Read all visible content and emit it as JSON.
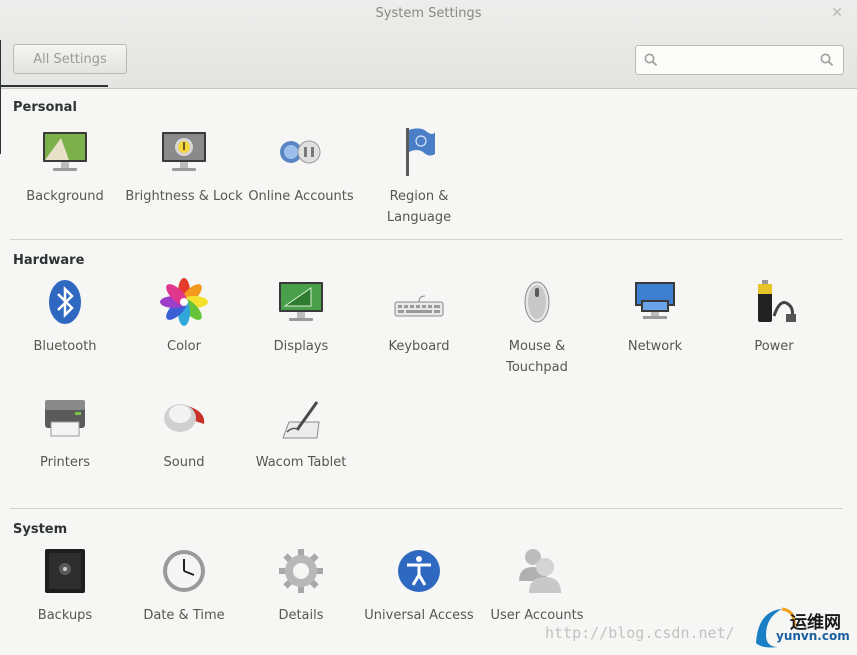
{
  "window": {
    "title": "System Settings"
  },
  "header": {
    "all_settings_label": "All Settings",
    "search_placeholder": ""
  },
  "sections": {
    "personal": {
      "title": "Personal",
      "items": [
        {
          "label": "Background",
          "icon": "background-icon"
        },
        {
          "label": "Brightness & Lock",
          "icon": "brightness-lock-icon"
        },
        {
          "label": "Online Accounts",
          "icon": "online-accounts-icon"
        },
        {
          "label": "Region & Language",
          "icon": "region-language-icon"
        }
      ]
    },
    "hardware": {
      "title": "Hardware",
      "items": [
        {
          "label": "Bluetooth",
          "icon": "bluetooth-icon"
        },
        {
          "label": "Color",
          "icon": "color-icon"
        },
        {
          "label": "Displays",
          "icon": "displays-icon"
        },
        {
          "label": "Keyboard",
          "icon": "keyboard-icon"
        },
        {
          "label": "Mouse & Touchpad",
          "icon": "mouse-icon"
        },
        {
          "label": "Network",
          "icon": "network-icon"
        },
        {
          "label": "Power",
          "icon": "power-icon"
        },
        {
          "label": "Printers",
          "icon": "printer-icon"
        },
        {
          "label": "Sound",
          "icon": "sound-icon"
        },
        {
          "label": "Wacom Tablet",
          "icon": "wacom-tablet-icon"
        }
      ]
    },
    "system": {
      "title": "System",
      "items": [
        {
          "label": "Backups",
          "icon": "backups-icon"
        },
        {
          "label": "Date & Time",
          "icon": "clock-icon"
        },
        {
          "label": "Details",
          "icon": "details-gear-icon"
        },
        {
          "label": "Universal Access",
          "icon": "universal-access-icon"
        },
        {
          "label": "User Accounts",
          "icon": "user-accounts-icon"
        }
      ]
    }
  },
  "watermark": {
    "url": "http://blog.csdn.net/",
    "logo_cn": "运维网",
    "logo_en": "yunvn.com"
  },
  "colors": {
    "accent_blue": "#3465a4",
    "divider": "#d3d3d0",
    "text": "#2e3436"
  }
}
